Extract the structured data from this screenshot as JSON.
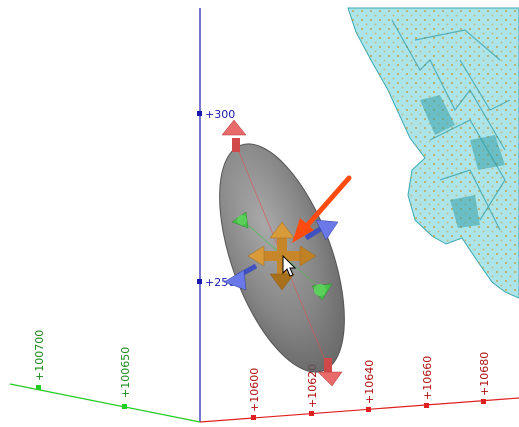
{
  "viewport": {
    "background": "#ffffff"
  },
  "axes": {
    "z": {
      "color": "#1a1ab0",
      "labels": [
        "+300",
        "+250"
      ]
    },
    "x": {
      "color": "#e02020",
      "labels": [
        "+10600",
        "+10620",
        "+10640",
        "+10660",
        "+10680"
      ]
    },
    "y": {
      "color": "#22cc22",
      "labels": [
        "+100700",
        "+100650"
      ]
    }
  },
  "widget": {
    "ellipsoid_icon": "ellipsoid-search-volume",
    "move_handle_icon": "four-way-move-icon",
    "handle_colors": {
      "red": "#e05050",
      "green": "#40c040",
      "blue": "#5060d8",
      "move": "#d08a2a"
    }
  },
  "annotation": {
    "arrow_icon": "pointer-arrow-icon",
    "color": "#ff4a10"
  },
  "cursor": {
    "icon": "mouse-cursor-icon"
  },
  "surface": {
    "color": "#66d0d8",
    "name_icon": "orebody-wireframe-surface"
  }
}
